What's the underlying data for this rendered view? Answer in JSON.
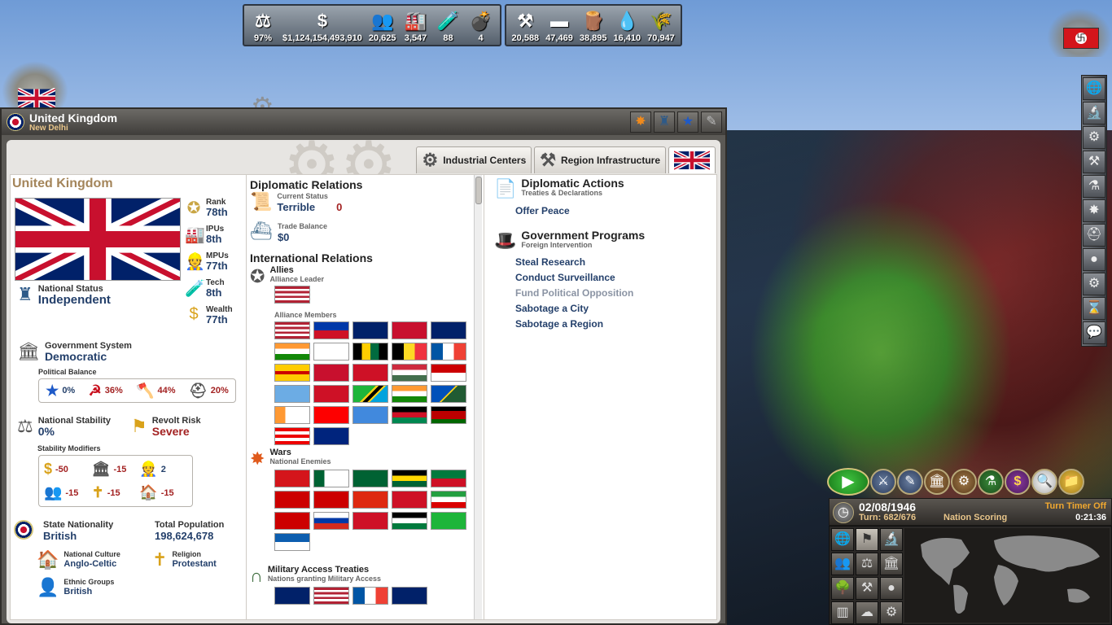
{
  "resources": {
    "group1": [
      {
        "icon": "scales-icon",
        "glyph": "⚖",
        "value": "97%"
      },
      {
        "icon": "dollar-icon",
        "glyph": "$",
        "value": "$1,124,154,493,910"
      },
      {
        "icon": "population-icon",
        "glyph": "👥",
        "value": "20,625"
      },
      {
        "icon": "factory-icon",
        "glyph": "🏭",
        "value": "3,547"
      },
      {
        "icon": "research-icon",
        "glyph": "🧪",
        "value": "88"
      },
      {
        "icon": "grenade-icon",
        "glyph": "💣",
        "value": "4"
      }
    ],
    "group2": [
      {
        "icon": "ore-icon",
        "glyph": "⚒",
        "value": "20,588"
      },
      {
        "icon": "steel-icon",
        "glyph": "▬",
        "value": "47,469"
      },
      {
        "icon": "wood-icon",
        "glyph": "🪵",
        "value": "38,895"
      },
      {
        "icon": "oil-icon",
        "glyph": "💧",
        "value": "16,410"
      },
      {
        "icon": "agriculture-icon",
        "glyph": "🌾",
        "value": "70,947"
      }
    ]
  },
  "window": {
    "title": "United Kingdom",
    "subtitle": "New Delhi",
    "tabs": {
      "industrial": "Industrial Centers",
      "infrastructure": "Region Infrastructure"
    }
  },
  "left": {
    "country_name": "United Kingdom",
    "rank": {
      "label": "Rank",
      "value": "78th"
    },
    "ipus": {
      "label": "IPUs",
      "value": "8th"
    },
    "mpus": {
      "label": "MPUs",
      "value": "77th"
    },
    "tech": {
      "label": "Tech",
      "value": "8th"
    },
    "wealth": {
      "label": "Wealth",
      "value": "77th"
    },
    "national_status": {
      "label": "National Status",
      "value": "Independent"
    },
    "government": {
      "label": "Government System",
      "value": "Democratic"
    },
    "political_balance": {
      "label": "Political Balance",
      "items": [
        {
          "icon": "star-icon",
          "glyph": "★",
          "value": "0%"
        },
        {
          "icon": "hammer-sickle-icon",
          "glyph": "☭",
          "value": "36%"
        },
        {
          "icon": "fascist-icon",
          "glyph": "🪓",
          "value": "44%"
        },
        {
          "icon": "helmet-icon",
          "glyph": "⛑",
          "value": "20%"
        }
      ]
    },
    "stability": {
      "label": "National Stability",
      "value": "0%"
    },
    "revolt": {
      "label": "Revolt Risk",
      "value": "Severe"
    },
    "stability_modifiers": {
      "label": "Stability Modifiers",
      "items": [
        {
          "icon": "dollar-icon",
          "glyph": "$",
          "value": "-50"
        },
        {
          "icon": "column-icon",
          "glyph": "🏛",
          "value": "-15"
        },
        {
          "icon": "worker-icon",
          "glyph": "👷",
          "value": "2"
        },
        {
          "icon": "people-icon",
          "glyph": "👥",
          "value": "-15"
        },
        {
          "icon": "cross-icon",
          "glyph": "✝",
          "value": "-15"
        },
        {
          "icon": "building-icon",
          "glyph": "🏠",
          "value": "-15"
        }
      ]
    },
    "state_nationality": {
      "label": "State Nationality",
      "value": "British"
    },
    "total_population": {
      "label": "Total Population",
      "value": "198,624,678"
    },
    "national_culture": {
      "label": "National Culture",
      "value": "Anglo-Celtic"
    },
    "religion": {
      "label": "Religion",
      "value": "Protestant"
    },
    "ethnic_groups": {
      "label": "Ethnic Groups",
      "value": "British"
    }
  },
  "middle": {
    "diplomatic_relations": "Diplomatic Relations",
    "current_status_label": "Current Status",
    "current_status_value": "Terrible",
    "current_status_num": "0",
    "trade_balance_label": "Trade Balance",
    "trade_balance_value": "$0",
    "international_relations": "International Relations",
    "allies_label": "Allies",
    "allies_sub": "Alliance Leader",
    "alliance_members_label": "Alliance Members",
    "wars_label": "Wars",
    "wars_sub": "National Enemies",
    "military_access_label": "Military Access Treaties",
    "military_access_sub": "Nations granting Military Access"
  },
  "right": {
    "diplomatic_actions": "Diplomatic Actions",
    "diplomatic_actions_sub": "Treaties & Declarations",
    "offer_peace": "Offer Peace",
    "government_programs": "Government Programs",
    "government_programs_sub": "Foreign Intervention",
    "actions": [
      {
        "label": "Steal Research",
        "enabled": true
      },
      {
        "label": "Conduct Surveillance",
        "enabled": true
      },
      {
        "label": "Fund Political Opposition",
        "enabled": false
      },
      {
        "label": "Sabotage a City",
        "enabled": true
      },
      {
        "label": "Sabotage a Region",
        "enabled": true
      }
    ]
  },
  "bottom_panel": {
    "date": "02/08/1946",
    "turn": "Turn: 682/676",
    "nation_scoring": "Nation Scoring",
    "turn_timer": "Turn Timer Off",
    "clock": "0:21:36"
  }
}
